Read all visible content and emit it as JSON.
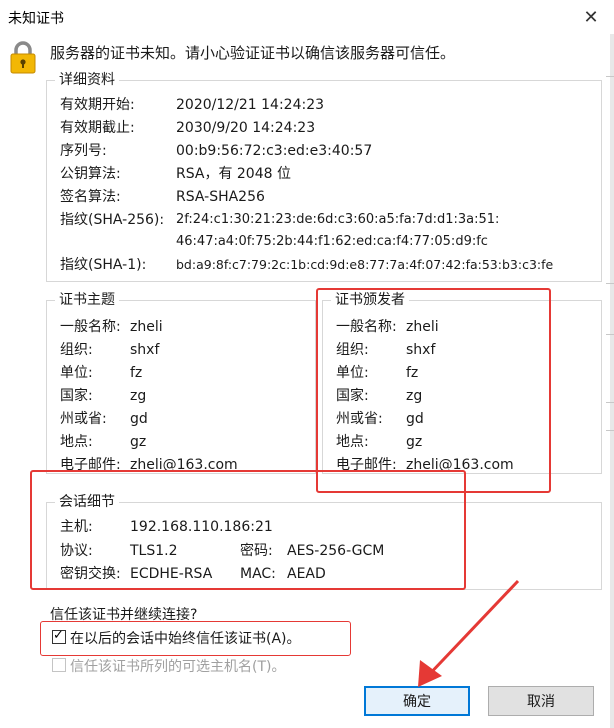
{
  "window": {
    "title": "未知证书"
  },
  "warning": "服务器的证书未知。请小心验证证书以确信该服务器可信任。",
  "details": {
    "legend": "详细资料",
    "rows": [
      {
        "label": "有效期开始:",
        "value": "2020/12/21 14:24:23"
      },
      {
        "label": "有效期截止:",
        "value": "2030/9/20 14:24:23"
      },
      {
        "label": "序列号:",
        "value": "00:b9:56:72:c3:ed:e3:40:57"
      },
      {
        "label": "公钥算法:",
        "value": "RSA，有 2048 位"
      },
      {
        "label": "签名算法:",
        "value": "RSA-SHA256"
      },
      {
        "label": "指纹(SHA-256):",
        "value": "2f:24:c1:30:21:23:de:6d:c3:60:a5:fa:7d:d1:3a:51:",
        "value2": "46:47:a4:0f:75:2b:44:f1:62:ed:ca:f4:77:05:d9:fc"
      },
      {
        "label": "指纹(SHA-1):",
        "value": "bd:a9:8f:c7:79:2c:1b:cd:9d:e8:77:7a:4f:07:42:fa:53:b3:c3:fe"
      }
    ]
  },
  "subject": {
    "legend": "证书主题",
    "rows": [
      {
        "label": "一般名称:",
        "value": "zheli"
      },
      {
        "label": "组织:",
        "value": "shxf"
      },
      {
        "label": "单位:",
        "value": "fz"
      },
      {
        "label": "国家:",
        "value": "zg"
      },
      {
        "label": "州或省:",
        "value": "gd"
      },
      {
        "label": "地点:",
        "value": "gz"
      },
      {
        "label": "电子邮件:",
        "value": "zheli@163.com"
      }
    ]
  },
  "issuer": {
    "legend": "证书颁发者",
    "rows": [
      {
        "label": "一般名称:",
        "value": "zheli"
      },
      {
        "label": "组织:",
        "value": "shxf"
      },
      {
        "label": "单位:",
        "value": "fz"
      },
      {
        "label": "国家:",
        "value": "zg"
      },
      {
        "label": "州或省:",
        "value": "gd"
      },
      {
        "label": "地点:",
        "value": "gz"
      },
      {
        "label": "电子邮件:",
        "value": "zheli@163.com"
      }
    ]
  },
  "session": {
    "legend": "会话细节",
    "host_label": "主机:",
    "host_value": "192.168.110.186:21",
    "protocol_label": "协议:",
    "protocol_value": "TLS1.2",
    "cipher_label": "密码:",
    "cipher_value": "AES-256-GCM",
    "kex_label": "密钥交换:",
    "kex_value": "ECDHE-RSA",
    "mac_label": "MAC:",
    "mac_value": "AEAD"
  },
  "trust": {
    "question": "信任该证书并继续连接?",
    "always_trust_label": "在以后的会话中始终信任该证书(A)。",
    "always_trust_checked": true,
    "trust_alt_names_label": "信任该证书所列的可选主机名(T)。",
    "trust_alt_names_enabled": false
  },
  "buttons": {
    "ok": "确定",
    "cancel": "取消"
  },
  "colors": {
    "highlight": "#e53935",
    "accent": "#0078d7"
  }
}
